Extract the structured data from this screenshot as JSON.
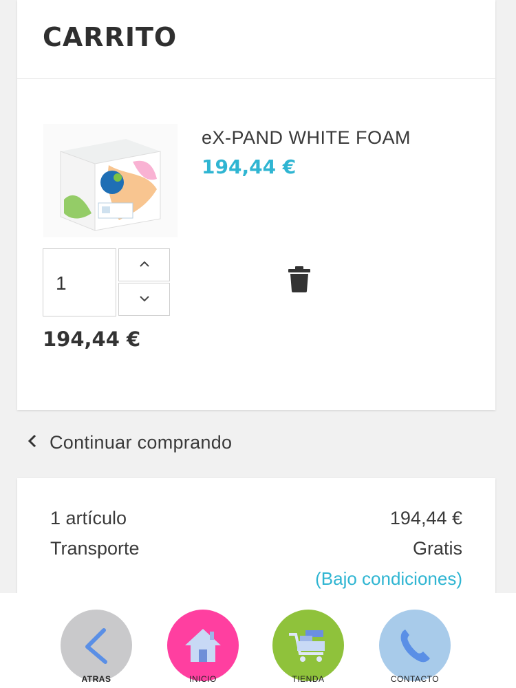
{
  "cart": {
    "title": "CARRITO",
    "item": {
      "name": "eX-PAND WHITE FOAM",
      "unit_price": "194,44 €",
      "quantity": "1",
      "line_total": "194,44 €"
    }
  },
  "continue_shopping": "Continuar comprando",
  "summary": {
    "items_label": "1 artículo",
    "items_value": "194,44 €",
    "shipping_label": "Transporte",
    "shipping_value": "Gratis",
    "shipping_note": "(Bajo condiciones)"
  },
  "bottom_nav": [
    {
      "label": "ATRAS",
      "icon": "back-chevron-icon",
      "color": "#c9c9cb"
    },
    {
      "label": "INICIO",
      "icon": "home-icon",
      "color": "#ff3fa0"
    },
    {
      "label": "TIENDA",
      "icon": "shopping-cart-icon",
      "color": "#8fc23b"
    },
    {
      "label": "CONTACTO",
      "icon": "phone-icon",
      "color": "#a8cbea"
    }
  ],
  "colors": {
    "accent": "#2fb5d2",
    "text": "#333333",
    "background": "#f1f1f1"
  }
}
